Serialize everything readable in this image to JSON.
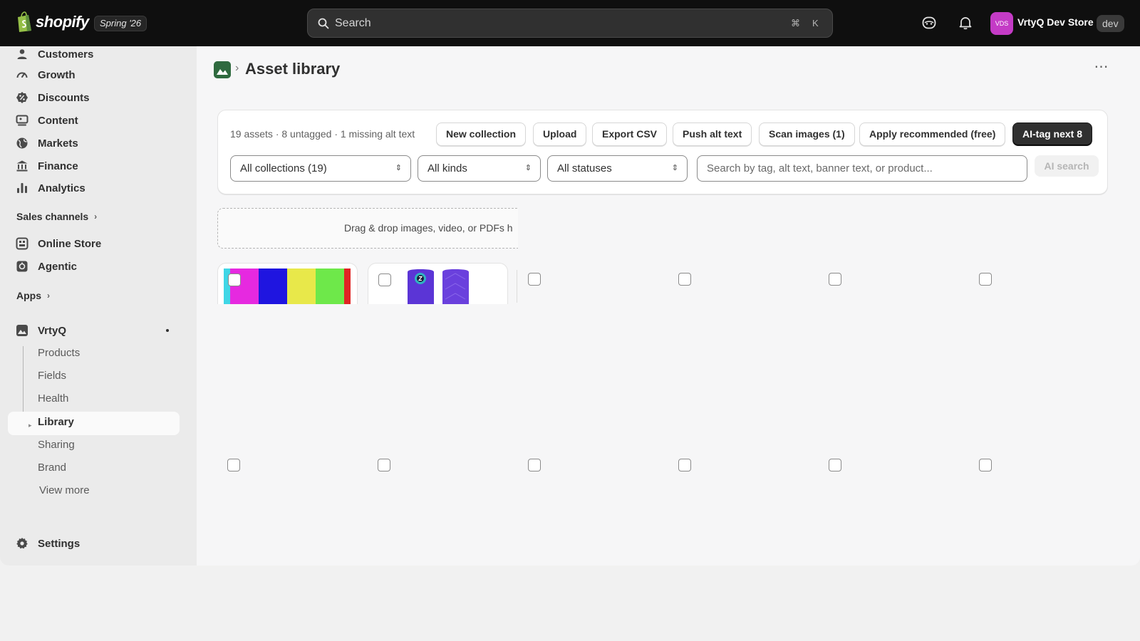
{
  "topbar": {
    "logo_text": "shopify",
    "release": "Spring '26",
    "search_placeholder": "Search",
    "shortcut_cmd": "⌘",
    "shortcut_key": "K",
    "avatar_initials": "VDS",
    "store_name": "VrtyQ Dev Store",
    "store_badge": "dev",
    "icons": [
      "shopify-bag-icon",
      "search-icon",
      "sidekick-icon",
      "bell-icon"
    ]
  },
  "sidebar": {
    "items": [
      {
        "label": "Customers",
        "icon": "person-icon"
      },
      {
        "label": "Growth",
        "icon": "gauge-icon"
      },
      {
        "label": "Discounts",
        "icon": "discount-icon"
      },
      {
        "label": "Content",
        "icon": "content-icon"
      },
      {
        "label": "Markets",
        "icon": "globe-icon"
      },
      {
        "label": "Finance",
        "icon": "bank-icon"
      },
      {
        "label": "Analytics",
        "icon": "bar-chart-icon"
      }
    ],
    "sales_channels_label": "Sales channels",
    "channels": [
      {
        "label": "Online Store",
        "icon": "store-icon"
      },
      {
        "label": "Agentic",
        "icon": "agentic-icon"
      }
    ],
    "apps_label": "Apps",
    "app": {
      "label": "VrtyQ",
      "icon": "image-app-icon"
    },
    "app_sub_items": [
      "Products",
      "Fields",
      "Health",
      "Library",
      "Sharing",
      "Brand"
    ],
    "active_sub_item": "Library",
    "view_more": "View more",
    "settings_label": "Settings"
  },
  "page": {
    "title": "Asset library",
    "breadcrumb_separator": "›",
    "more_actions": "⋯"
  },
  "toolbar": {
    "summary": "19 assets · 8 untagged · 1 missing alt text",
    "buttons": {
      "new_collection": "New collection",
      "upload": "Upload",
      "export_csv": "Export CSV",
      "push_alt_text": "Push alt text",
      "scan_images": "Scan images (1)",
      "apply_recommended": "Apply recommended (free)",
      "ai_tag_next": "AI-tag next 8"
    },
    "filters": {
      "collections": "All collections (19)",
      "kinds": "All kinds",
      "statuses": "All statuses",
      "search_placeholder": "Search by tag, alt text, banner text, or product...",
      "ai_search": "AI search"
    }
  },
  "dropzone": {
    "text": "Drag & drop images, video, or PDFs h"
  },
  "colors": {
    "topbar_bg": "#0f0f0f",
    "primary_button": "#303030",
    "avatar": "#c43bc6",
    "app_icon": "#2f6a3f",
    "thumb_stripes": [
      "#40d6e6",
      "#e629e0",
      "#1f15e0",
      "#e8e84a",
      "#6ee84a",
      "#e02424"
    ],
    "thumb_purple": "#5b35d6"
  }
}
